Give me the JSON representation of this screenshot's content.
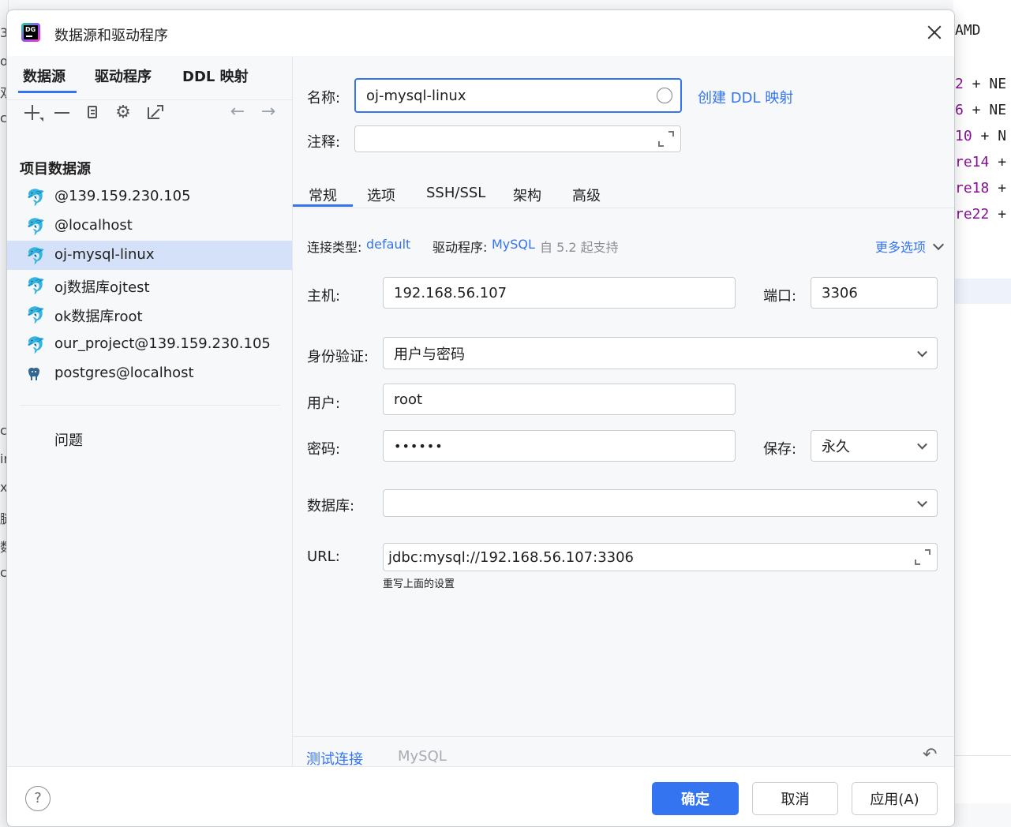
{
  "background": {
    "left_glyphs": [
      "3",
      "o",
      "双",
      "c",
      "",
      "",
      "",
      "",
      "",
      "",
      "",
      "",
      "",
      "",
      "c",
      "ir",
      "x",
      "腿",
      "数",
      "c",
      "",
      "",
      "",
      "",
      "",
      "",
      "",
      "",
      ""
    ],
    "code_top": "AMD",
    "code_lines": [
      {
        "pre": "2",
        "post": " + NE"
      },
      {
        "pre": "6",
        "post": " + NE"
      },
      {
        "pre": "10",
        "post": " + N"
      },
      {
        "pre": "re14",
        "post": " +"
      },
      {
        "pre": "re18",
        "post": " +"
      },
      {
        "pre": "re22",
        "post": " +"
      }
    ]
  },
  "dialog": {
    "app_icon_text": "DG",
    "title": "数据源和驱动程序"
  },
  "left": {
    "tabs": [
      {
        "label": "数据源",
        "active": true
      },
      {
        "label": "驱动程序",
        "active": false
      },
      {
        "label": "DDL 映射",
        "active": false
      }
    ],
    "toolbar": {
      "add": "add-icon",
      "remove": "remove-icon",
      "duplicate": "copy-icon",
      "settings": "gear-icon",
      "external": "external-link-icon",
      "back": "←",
      "forward": "→"
    },
    "section_title": "项目数据源",
    "items": [
      {
        "label": "@139.159.230.105",
        "type": "mysql",
        "selected": false
      },
      {
        "label": "@localhost",
        "type": "mysql",
        "selected": false
      },
      {
        "label": "oj-mysql-linux",
        "type": "mysql",
        "selected": true
      },
      {
        "label": "oj数据库ojtest",
        "type": "mysql",
        "selected": false
      },
      {
        "label": "ok数据库root",
        "type": "mysql",
        "selected": false
      },
      {
        "label": "our_project@139.159.230.105",
        "type": "mysql",
        "selected": false
      },
      {
        "label": "postgres@localhost",
        "type": "postgres",
        "selected": false
      }
    ],
    "problems_label": "问题"
  },
  "right": {
    "name_label": "名称:",
    "name_value": "oj-mysql-linux",
    "create_ddl_link": "创建 DDL 映射",
    "comment_label": "注释:",
    "comment_value": "",
    "tabs": [
      "常规",
      "选项",
      "SSH/SSL",
      "架构",
      "高级"
    ],
    "active_tab": "常规",
    "conn_type_label": "连接类型:",
    "conn_type_value": "default",
    "driver_label": "驱动程序:",
    "driver_value": "MySQL",
    "driver_note": "自 5.2 起支持",
    "more_options": "更多选项",
    "host_label": "主机:",
    "host_value": "192.168.56.107",
    "port_label": "端口:",
    "port_value": "3306",
    "auth_label": "身份验证:",
    "auth_value": "用户与密码",
    "user_label": "用户:",
    "user_value": "root",
    "password_label": "密码:",
    "password_value": "••••••",
    "save_label": "保存:",
    "save_value": "永久",
    "database_label": "数据库:",
    "database_value": "",
    "url_label": "URL:",
    "url_value": "jdbc:mysql://192.168.56.107:3306",
    "url_hint": "重写上面的设置",
    "test_connection": "测试连接",
    "driver_footer": "MySQL",
    "undo_icon": "↶"
  },
  "footer": {
    "help": "?",
    "ok": "确定",
    "cancel": "取消",
    "apply": "应用(A)"
  },
  "colors": {
    "accent": "#3574f0",
    "selected_row": "#d5e1f8",
    "keyword": "#871094"
  }
}
